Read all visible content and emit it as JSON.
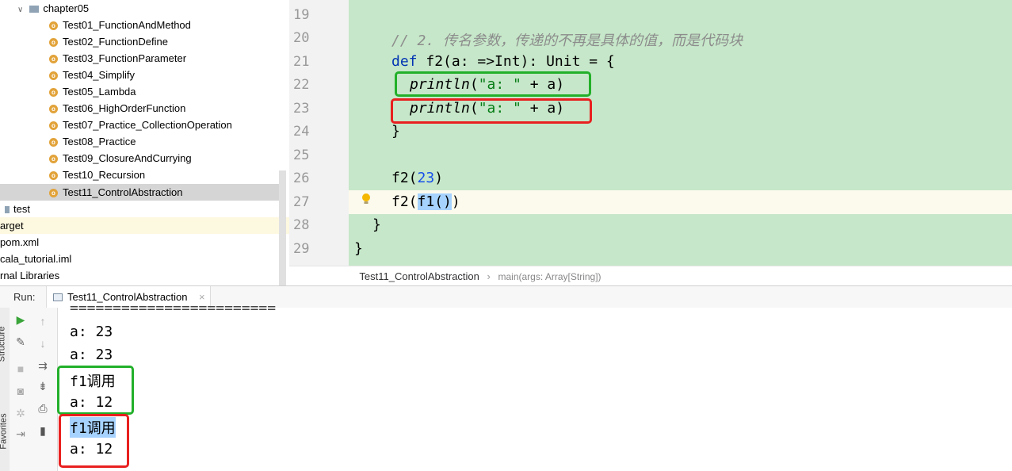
{
  "tree": {
    "folder": "chapter05",
    "items": [
      "Test01_FunctionAndMethod",
      "Test02_FunctionDefine",
      "Test03_FunctionParameter",
      "Test04_Simplify",
      "Test05_Lambda",
      "Test06_HighOrderFunction",
      "Test07_Practice_CollectionOperation",
      "Test08_Practice",
      "Test09_ClosureAndCurrying",
      "Test10_Recursion",
      "Test11_ControlAbstraction"
    ],
    "test_folder": "test",
    "target": "arget",
    "pom": "pom.xml",
    "iml": "cala_tutorial.iml",
    "libs": "rnal Libraries"
  },
  "editor": {
    "line_numbers": [
      "19",
      "20",
      "21",
      "22",
      "23",
      "24",
      "25",
      "26",
      "27",
      "28",
      "29"
    ],
    "comment": "// 2. 传名参数，传递的不再是具体的值，而是代码块",
    "def_kw": "def",
    "def_rest": " f2(a: =>Int): Unit = {",
    "println": "println",
    "print_open": "(",
    "print_str": "\"a: \"",
    "print_rest": " + a)",
    "close_brace": "}",
    "call1_pre": "f2(",
    "call1_num": "23",
    "call1_post": ")",
    "call2_pre": "f2(",
    "call2_sel": "f1()",
    "call2_post": ")",
    "outer_brace": "}",
    "object_brace": "}"
  },
  "breadcrumb": {
    "file": "Test11_ControlAbstraction",
    "sep": "›",
    "method": "main(args: Array[String])"
  },
  "run": {
    "label": "Run:",
    "tab": "Test11_ControlAbstraction",
    "close": "×"
  },
  "console": {
    "separator": "========================",
    "lines": [
      "a: 23",
      "a: 23",
      "f1调用",
      "a: 12",
      "f1调用",
      "a: 12"
    ]
  },
  "sidebar": {
    "structure": "Structure",
    "favorites": "Favorites"
  },
  "colors": {
    "editor_bg": "#c6e7c9",
    "highlight_green": "#22b02a",
    "highlight_red": "#e8201f",
    "keyword": "#0033b3",
    "string": "#067d17"
  }
}
